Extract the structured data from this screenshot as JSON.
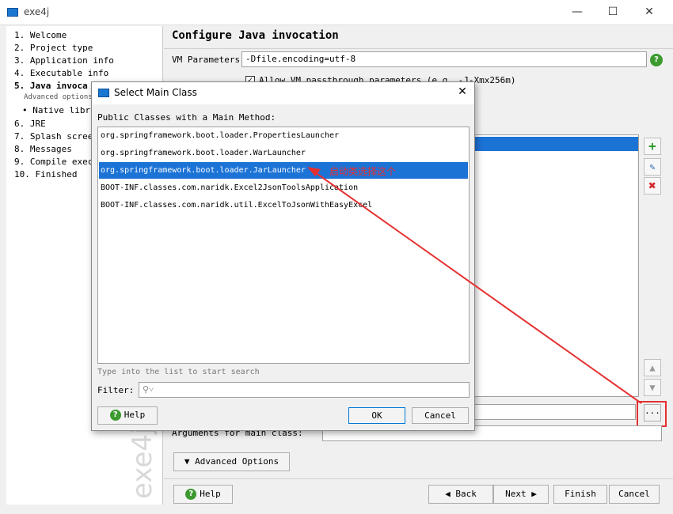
{
  "window": {
    "title": "exe4j"
  },
  "steps": [
    {
      "label": "1. Welcome",
      "bold": false
    },
    {
      "label": "2. Project type",
      "bold": false
    },
    {
      "label": "3. Application info",
      "bold": false
    },
    {
      "label": "4. Executable info",
      "bold": false
    },
    {
      "label": "5. Java invoca",
      "bold": true
    },
    {
      "label": "Advanced options:",
      "bold": false
    },
    {
      "label": "• Native libra",
      "bold": false
    },
    {
      "label": "6. JRE",
      "bold": false
    },
    {
      "label": "7. Splash screen",
      "bold": false
    },
    {
      "label": "8. Messages",
      "bold": false
    },
    {
      "label": "9. Compile execu",
      "bold": false
    },
    {
      "label": "10. Finished",
      "bold": false
    }
  ],
  "watermark": "exe4j",
  "main": {
    "heading": "Configure Java invocation",
    "vm_label": "VM Parameters:",
    "vm_value": "-Dfile.encoding=utf-8",
    "allow_passthrough": "Allow VM passthrough parameters (e.g. -J-Xmx256m)",
    "args_label": "Arguments for main class:",
    "advanced_button": "Advanced Options",
    "browse_button": "...",
    "help_button": "Help",
    "back_button": "Back",
    "next_button": "Next",
    "finish_button": "Finish",
    "cancel_button": "Cancel"
  },
  "dialog": {
    "title": "Select Main Class",
    "list_label": "Public Classes with a Main Method:",
    "classes": [
      "org.springframework.boot.loader.PropertiesLauncher",
      "org.springframework.boot.loader.WarLauncher",
      "org.springframework.boot.loader.JarLauncher",
      "BOOT-INF.classes.com.naridk.Excel2JsonToolsApplication",
      "BOOT-INF.classes.com.naridk.util.ExcelToJsonWithEasyExcel"
    ],
    "selected_index": 2,
    "search_hint": "Type into the list to start search",
    "filter_label": "Filter:",
    "filter_value": "",
    "help_button": "Help",
    "ok_button": "OK",
    "cancel_button": "Cancel",
    "close_glyph": "✕"
  },
  "annotation": {
    "text": "启动类选择这个",
    "color": "#e53030"
  },
  "colors": {
    "selection": "#1c73d6",
    "annotation": "#e53030",
    "help_green": "#3c9a2f"
  }
}
